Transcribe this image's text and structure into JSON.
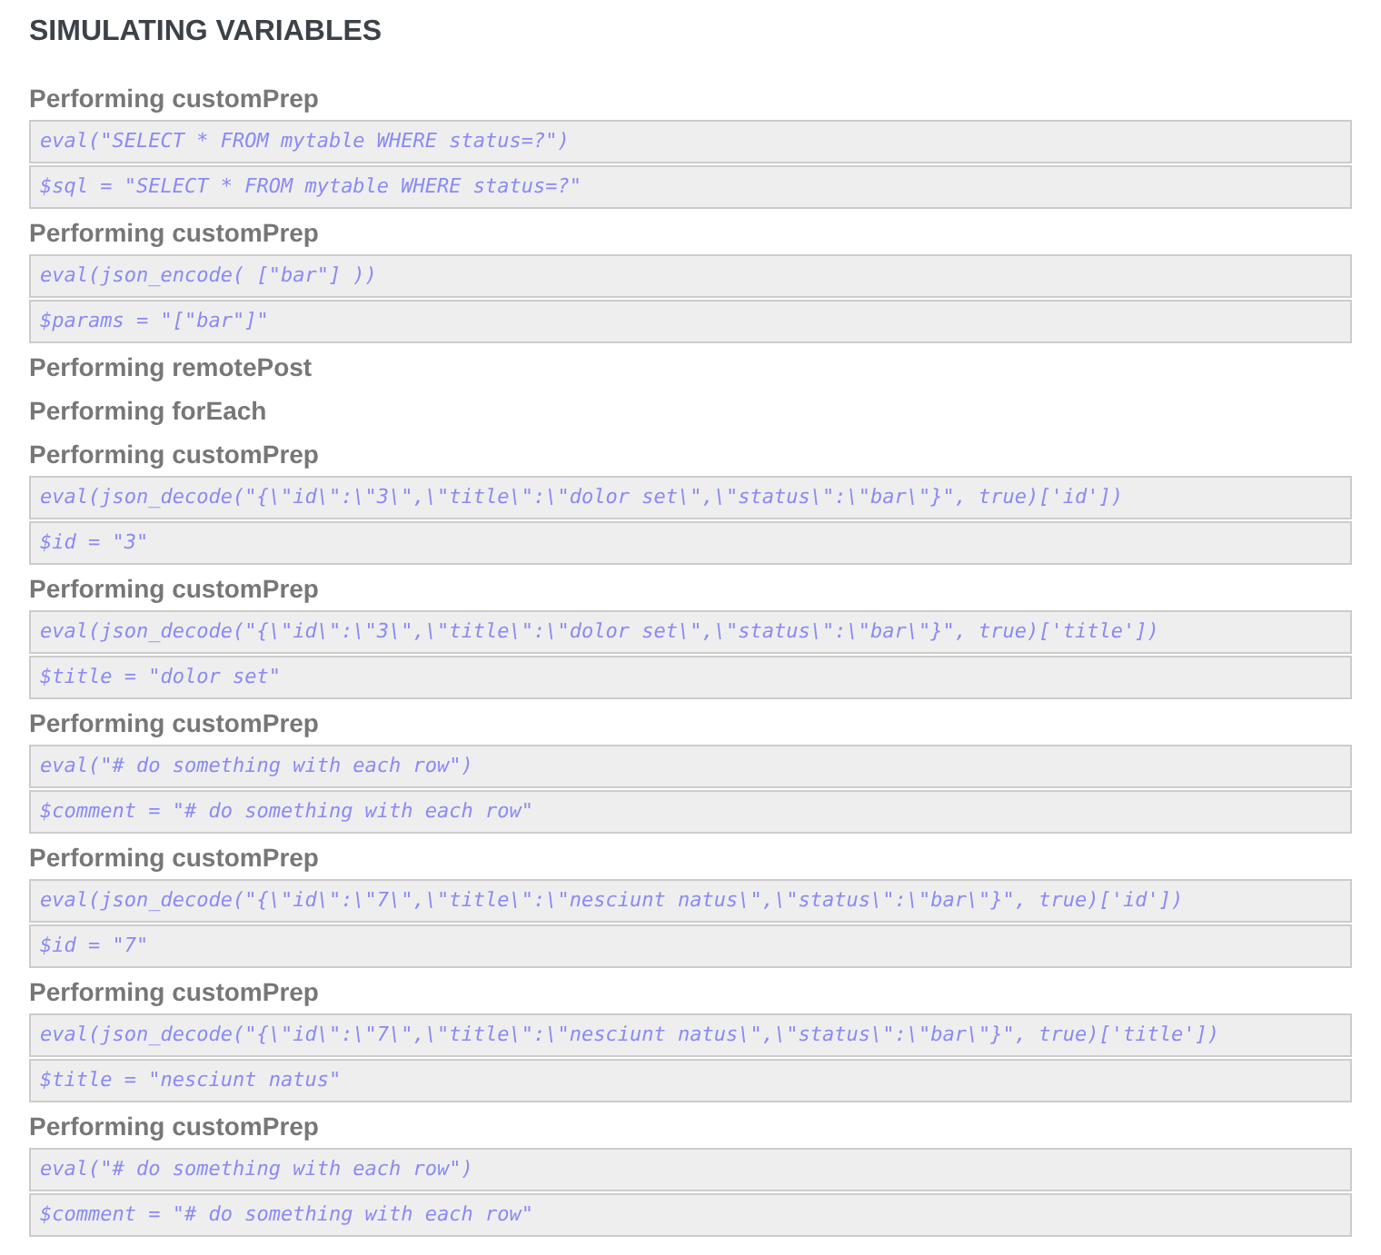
{
  "title": "SIMULATING VARIABLES",
  "steps": [
    {
      "heading": "Performing customPrep",
      "lines": [
        "eval(\"SELECT * FROM mytable WHERE status=?\")",
        "$sql = \"SELECT * FROM mytable WHERE status=?\""
      ]
    },
    {
      "heading": "Performing customPrep",
      "lines": [
        "eval(json_encode( [\"bar\"] ))",
        "$params = \"[\"bar\"]\""
      ]
    },
    {
      "heading": "Performing remotePost"
    },
    {
      "heading": "Performing forEach"
    },
    {
      "heading": "Performing customPrep",
      "lines": [
        "eval(json_decode(\"{\\\"id\\\":\\\"3\\\",\\\"title\\\":\\\"dolor set\\\",\\\"status\\\":\\\"bar\\\"}\", true)['id'])",
        "$id = \"3\""
      ]
    },
    {
      "heading": "Performing customPrep",
      "lines": [
        "eval(json_decode(\"{\\\"id\\\":\\\"3\\\",\\\"title\\\":\\\"dolor set\\\",\\\"status\\\":\\\"bar\\\"}\", true)['title'])",
        "$title = \"dolor set\""
      ]
    },
    {
      "heading": "Performing customPrep",
      "lines": [
        "eval(\"# do something with each row\")",
        "$comment = \"# do something with each row\""
      ]
    },
    {
      "heading": "Performing customPrep",
      "lines": [
        "eval(json_decode(\"{\\\"id\\\":\\\"7\\\",\\\"title\\\":\\\"nesciunt natus\\\",\\\"status\\\":\\\"bar\\\"}\", true)['id'])",
        "$id = \"7\""
      ]
    },
    {
      "heading": "Performing customPrep",
      "lines": [
        "eval(json_decode(\"{\\\"id\\\":\\\"7\\\",\\\"title\\\":\\\"nesciunt natus\\\",\\\"status\\\":\\\"bar\\\"}\", true)['title'])",
        "$title = \"nesciunt natus\""
      ]
    },
    {
      "heading": "Performing customPrep",
      "lines": [
        "eval(\"# do something with each row\")",
        "$comment = \"# do something with each row\""
      ]
    }
  ]
}
